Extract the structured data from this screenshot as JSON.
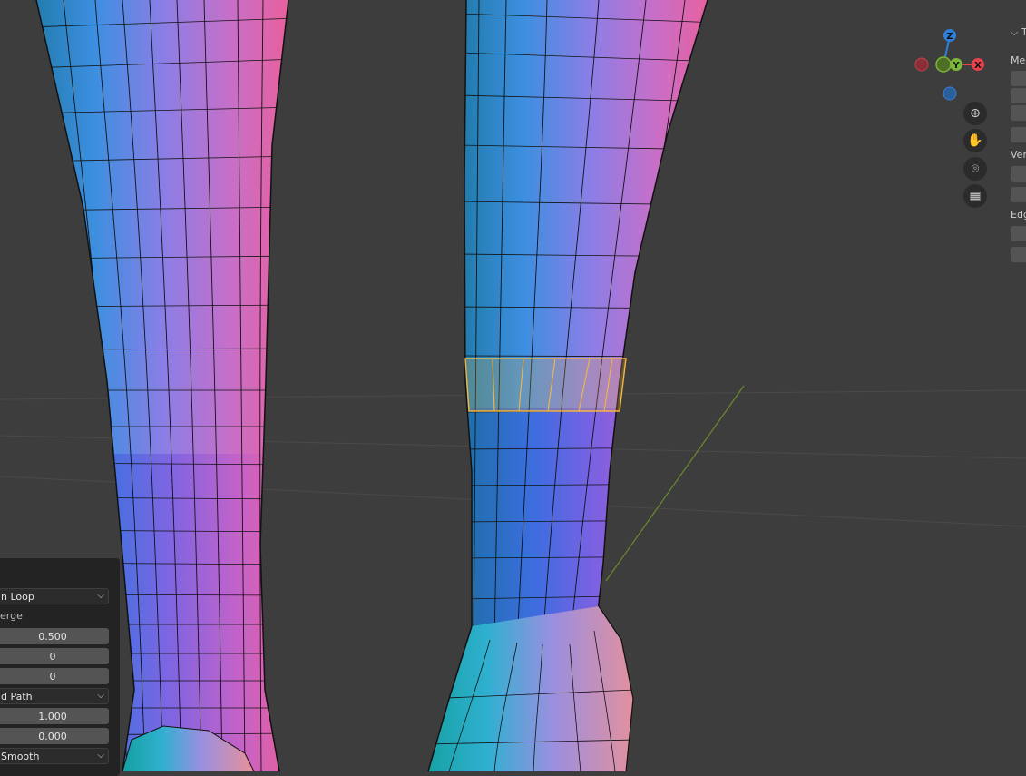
{
  "gizmo": {
    "z_label": "Z",
    "y_label": "Y",
    "x_label": "X",
    "colors": {
      "z": "#2f7fd8",
      "y": "#7cb537",
      "x": "#e8404d",
      "neg_x": "#8b2e36",
      "neg_z": "#2a5f9c"
    }
  },
  "nav_buttons": [
    {
      "icon": "zoom-icon",
      "glyph": "⊕"
    },
    {
      "icon": "hand-pan-icon",
      "glyph": "✋"
    },
    {
      "icon": "camera-icon",
      "glyph": "⌾"
    },
    {
      "icon": "grid-perspective-icon",
      "glyph": "▦"
    }
  ],
  "side_panel": {
    "header": "T",
    "section_mesh": "Me",
    "section_vertex": "Ver",
    "section_edge": "Edg"
  },
  "redo_panel": {
    "fields": [
      {
        "kind": "dropdown",
        "value": "n Loop"
      },
      {
        "kind": "label",
        "value": "erge"
      },
      {
        "kind": "number",
        "value": "0.500"
      },
      {
        "kind": "number",
        "value": "0"
      },
      {
        "kind": "number",
        "value": "0"
      },
      {
        "kind": "dropdown",
        "value": "d Path"
      },
      {
        "kind": "number",
        "value": "1.000"
      },
      {
        "kind": "number",
        "value": "0.000"
      },
      {
        "kind": "dropdown",
        "value": "Smooth"
      }
    ]
  },
  "colors": {
    "background": "#3d3d3d",
    "selection": "#f5b640",
    "mesh_wire": "#111111"
  }
}
